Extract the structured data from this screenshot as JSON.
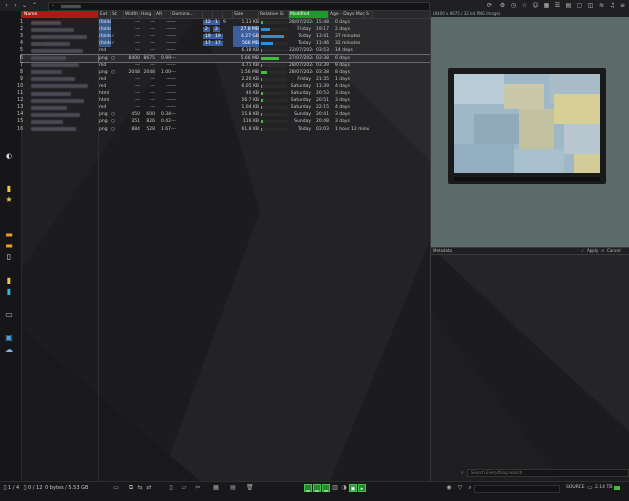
{
  "toolbar": {
    "address_prefix": "› ",
    "address_path": "",
    "right_icons": [
      "refresh-icon",
      "settings-icon",
      "history-icon",
      "star-icon",
      "user-icon",
      "grid-icon",
      "list-icon",
      "layout-icon",
      "panel-icon",
      "split-icon",
      "wifi-icon",
      "bell-icon",
      "menu-icon"
    ]
  },
  "tree": {
    "rows": [
      {
        "num": "1"
      },
      {
        "num": "2"
      },
      {
        "num": "3"
      },
      {
        "num": "4"
      },
      {
        "num": "5"
      },
      {
        "num": "6"
      },
      {
        "num": "7"
      },
      {
        "num": "8"
      },
      {
        "num": "9"
      },
      {
        "num": "10"
      },
      {
        "num": "11"
      },
      {
        "num": "12"
      },
      {
        "num": "13"
      },
      {
        "num": "14"
      },
      {
        "num": "15"
      },
      {
        "num": "16"
      }
    ]
  },
  "columns": {
    "name": "Name",
    "ext": "Ext",
    "status": "St",
    "width": "Width",
    "height": "Heig",
    "aspect": "AR",
    "dominant": "Domina...",
    "n1": "",
    "n2": "",
    "cnt": "",
    "size": "Size",
    "rel_size": "Relative Si",
    "modified": "Modified",
    "age": "Age - Days Modified",
    "age_short": "S"
  },
  "files": [
    {
      "ext": "(folder)",
      "st": "",
      "w": "---",
      "h": "---",
      "ar": "---",
      "dom": "---",
      "n1": "12",
      "n2": "1",
      "cnt": "9",
      "size": "1.13 KB",
      "rel": 8,
      "mod": "28/07/2024",
      "time": "15:48",
      "age": "0 days",
      "blue": false
    },
    {
      "ext": "(folder)",
      "st": "",
      "w": "---",
      "h": "---",
      "ar": "---",
      "dom": "---",
      "n1": "2",
      "n2": "2",
      "cnt": "",
      "size": "27.8 MB",
      "rel": 35,
      "mod": "Friday",
      "time": "19:17",
      "age": "2 days",
      "blue": true
    },
    {
      "ext": "(folder)",
      "st": "✓",
      "w": "---",
      "h": "---",
      "ar": "---",
      "dom": "---",
      "n1": "19",
      "n2": "19",
      "cnt": "",
      "size": "4.27 GB",
      "rel": 90,
      "mod": "Today",
      "time": "13:41",
      "age": "37 minutes",
      "blue": true
    },
    {
      "ext": "(folder)",
      "st": "✓",
      "w": "---",
      "h": "---",
      "ar": "---",
      "dom": "---",
      "n1": "17",
      "n2": "17",
      "cnt": "",
      "size": "566 MB",
      "rel": 45,
      "mod": "Today",
      "time": "11:46",
      "age": "32 minutes",
      "blue": true
    },
    {
      "ext": "md",
      "st": "",
      "w": "---",
      "h": "---",
      "ar": "---",
      "dom": "---",
      "n1": "",
      "n2": "",
      "cnt": "",
      "size": "6.18 KB",
      "rel": 4,
      "mod": "22/07/2024",
      "time": "03:53",
      "age": "14 days",
      "blue": false
    },
    {
      "ext": "png",
      "st": "○",
      "w": "8400",
      "h": "8675",
      "ar": "0.99",
      "dom": "---",
      "n1": "",
      "n2": "",
      "cnt": "",
      "size": "5.66 MB",
      "rel": 70,
      "mod": "27/07/2024",
      "time": "03:38",
      "age": "6 days",
      "blue": false,
      "sel": true
    },
    {
      "ext": "md",
      "st": "",
      "w": "---",
      "h": "---",
      "ar": "---",
      "dom": "---",
      "n1": "",
      "n2": "",
      "cnt": "",
      "size": "4.71 KB",
      "rel": 3,
      "mod": "28/07/2024",
      "time": "03:39",
      "age": "9 days",
      "blue": false
    },
    {
      "ext": "png",
      "st": "○",
      "w": "2048",
      "h": "2048",
      "ar": "1.00",
      "dom": "---",
      "n1": "",
      "n2": "",
      "cnt": "",
      "size": "1.56 MB",
      "rel": 22,
      "mod": "28/07/2024",
      "time": "03:38",
      "age": "8 days",
      "blue": false
    },
    {
      "ext": "md",
      "st": "",
      "w": "---",
      "h": "---",
      "ar": "---",
      "dom": "---",
      "n1": "",
      "n2": "",
      "cnt": "",
      "size": "2.20 KB",
      "rel": 2,
      "mod": "Friday",
      "time": "21:35",
      "age": "1 days",
      "blue": false
    },
    {
      "ext": "md",
      "st": "",
      "w": "---",
      "h": "---",
      "ar": "---",
      "dom": "---",
      "n1": "",
      "n2": "",
      "cnt": "",
      "size": "6.05 KB",
      "rel": 4,
      "mod": "Saturday",
      "time": "11:39",
      "age": "4 days",
      "blue": false
    },
    {
      "ext": "html",
      "st": "",
      "w": "---",
      "h": "---",
      "ar": "---",
      "dom": "---",
      "n1": "",
      "n2": "",
      "cnt": "",
      "size": "40 KB",
      "rel": 6,
      "mod": "Saturday",
      "time": "20:53",
      "age": "3 days",
      "blue": false
    },
    {
      "ext": "html",
      "st": "",
      "w": "---",
      "h": "---",
      "ar": "---",
      "dom": "---",
      "n1": "",
      "n2": "",
      "cnt": "",
      "size": "56.7 KB",
      "rel": 7,
      "mod": "Saturday",
      "time": "20:51",
      "age": "3 days",
      "blue": false
    },
    {
      "ext": "md",
      "st": "",
      "w": "---",
      "h": "---",
      "ar": "---",
      "dom": "---",
      "n1": "",
      "n2": "",
      "cnt": "",
      "size": "1.04 KB",
      "rel": 2,
      "mod": "Saturday",
      "time": "22:15",
      "age": "4 days",
      "blue": false
    },
    {
      "ext": "png",
      "st": "○",
      "w": "450",
      "h": "600",
      "ar": "0.34",
      "dom": "---",
      "n1": "",
      "n2": "",
      "cnt": "",
      "size": "15.8 KB",
      "rel": 4,
      "mod": "Sunday",
      "time": "20:41",
      "age": "3 days",
      "blue": false
    },
    {
      "ext": "png",
      "st": "○",
      "w": "351",
      "h": "826",
      "ar": "0.42",
      "dom": "---",
      "n1": "",
      "n2": "",
      "cnt": "",
      "size": "116 KB",
      "rel": 6,
      "mod": "Sunday",
      "time": "20:48",
      "age": "3 days",
      "blue": false
    },
    {
      "ext": "png",
      "st": "○",
      "w": "884",
      "h": "528",
      "ar": "1.67",
      "dom": "---",
      "n1": "",
      "n2": "",
      "cnt": "",
      "size": "61.8 KB",
      "rel": 5,
      "mod": "Today",
      "time": "03:03",
      "age": "1 hour 12 minutes",
      "blue": false
    }
  ],
  "preview": {
    "title": "(8400 x 8675 / 32 bit PNG Image)"
  },
  "metadata": {
    "title": "Metadata",
    "apply_label": "Apply",
    "cancel_label": "Cancel",
    "search_placeholder": "Search Everything search"
  },
  "status": {
    "selected": "1 / 4",
    "files": "0 / 12",
    "bytes": "0 bytes / 5.53 GB",
    "source": "SOURCE",
    "free": "2.14 TB"
  },
  "colors": {
    "name_header": "#b01818",
    "modified_header": "#1e9a2a",
    "size_bar": "#3fbf3f",
    "size_bar_blue": "#2f8fd6",
    "badge": "#3a5ea0"
  }
}
